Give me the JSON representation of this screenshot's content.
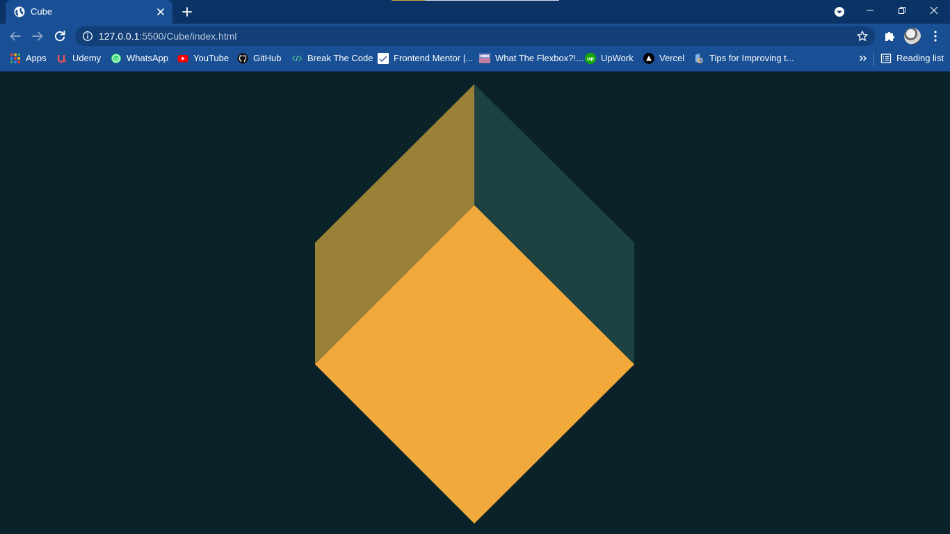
{
  "browser": {
    "tab": {
      "title": "Cube"
    },
    "address_bar": {
      "host": "127.0.0.1",
      "path": ":5500/Cube/index.html"
    },
    "reading_list_label": "Reading list"
  },
  "bookmarks": [
    {
      "label": "Apps",
      "icon": "apps-grid-icon"
    },
    {
      "label": "Udemy",
      "icon": "udemy-icon"
    },
    {
      "label": "WhatsApp",
      "icon": "whatsapp-icon"
    },
    {
      "label": "YouTube",
      "icon": "youtube-icon"
    },
    {
      "label": "GitHub",
      "icon": "github-icon"
    },
    {
      "label": "Break The Code",
      "icon": "code-icon"
    },
    {
      "label": "Frontend Mentor |...",
      "icon": "frontend-mentor-icon"
    },
    {
      "label": "What The Flexbox?!...",
      "icon": "flexbox-icon"
    },
    {
      "label": "UpWork",
      "icon": "upwork-icon"
    },
    {
      "label": "Vercel",
      "icon": "vercel-icon"
    },
    {
      "label": "Tips for Improving t...",
      "icon": "tips-icon"
    }
  ],
  "page": {
    "background": "#0b2228",
    "cube": {
      "left_face_color": "#998238",
      "right_face_color": "#1d4241",
      "front_face_color": "#f2a93b"
    }
  },
  "theme": {
    "tabstrip": "#0c3366",
    "toolbar": "#184f95",
    "omnibox": "#123f78"
  }
}
